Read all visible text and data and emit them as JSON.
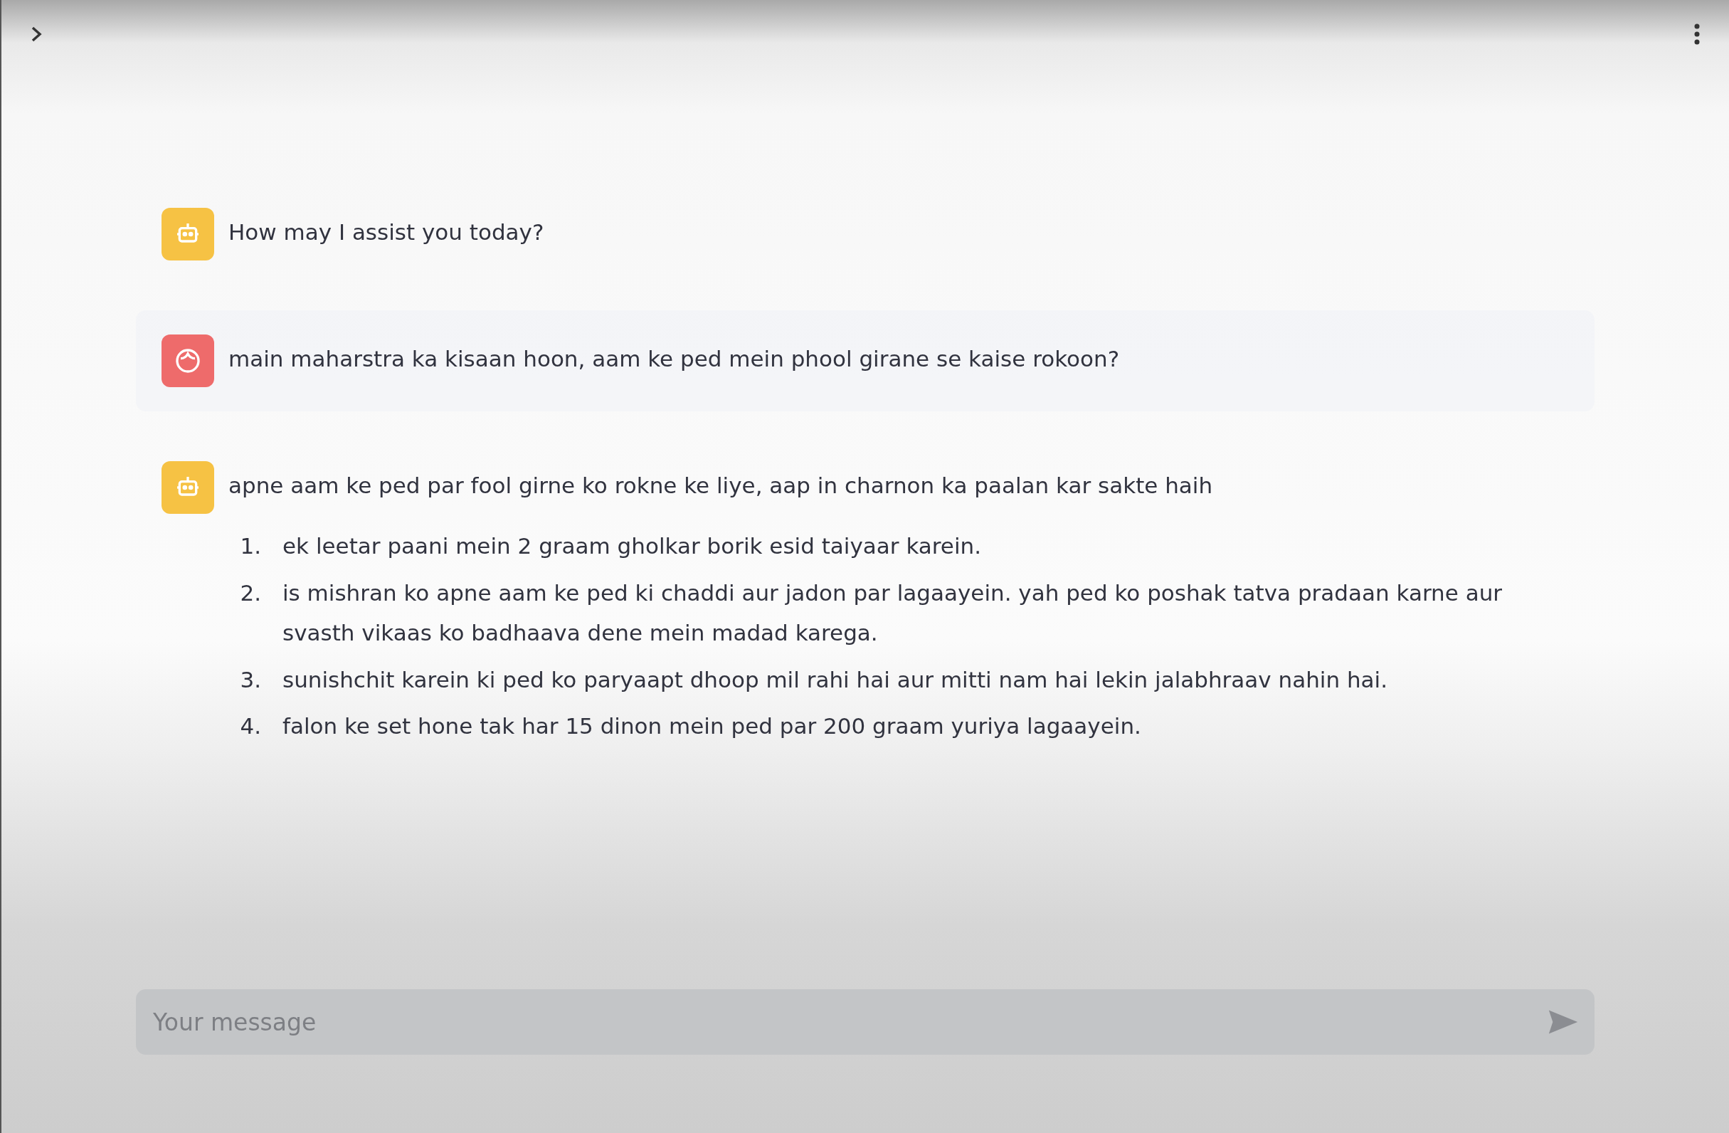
{
  "messages": [
    {
      "kind": "assistant",
      "text": "How may I assist you today?"
    },
    {
      "kind": "user",
      "text": "main maharstra ka kisaan hoon, aam ke ped mein phool girane se kaise rokoon?"
    },
    {
      "kind": "assistant",
      "text": "apne aam ke ped par fool girne ko rokne ke liye, aap in charnon ka paalan kar sakte haih",
      "list": [
        {
          "number": "1.",
          "text": "ek leetar paani mein 2 graam gholkar borik esid taiyaar karein."
        },
        {
          "number": "2.",
          "text": "is mishran ko apne aam ke ped ki chaddi aur jadon par lagaayein. yah ped ko poshak tatva pradaan karne aur svasth vikaas ko badhaava dene mein madad karega."
        },
        {
          "number": "3.",
          "text": "sunishchit karein ki ped ko paryaapt dhoop mil rahi hai aur mitti nam hai lekin jalabhraav nahin hai."
        },
        {
          "number": "4.",
          "text": "falon ke set hone tak har 15 dinon mein ped par 200 graam yuriya lagaayein."
        }
      ]
    }
  ],
  "input": {
    "placeholder": "Your message"
  }
}
